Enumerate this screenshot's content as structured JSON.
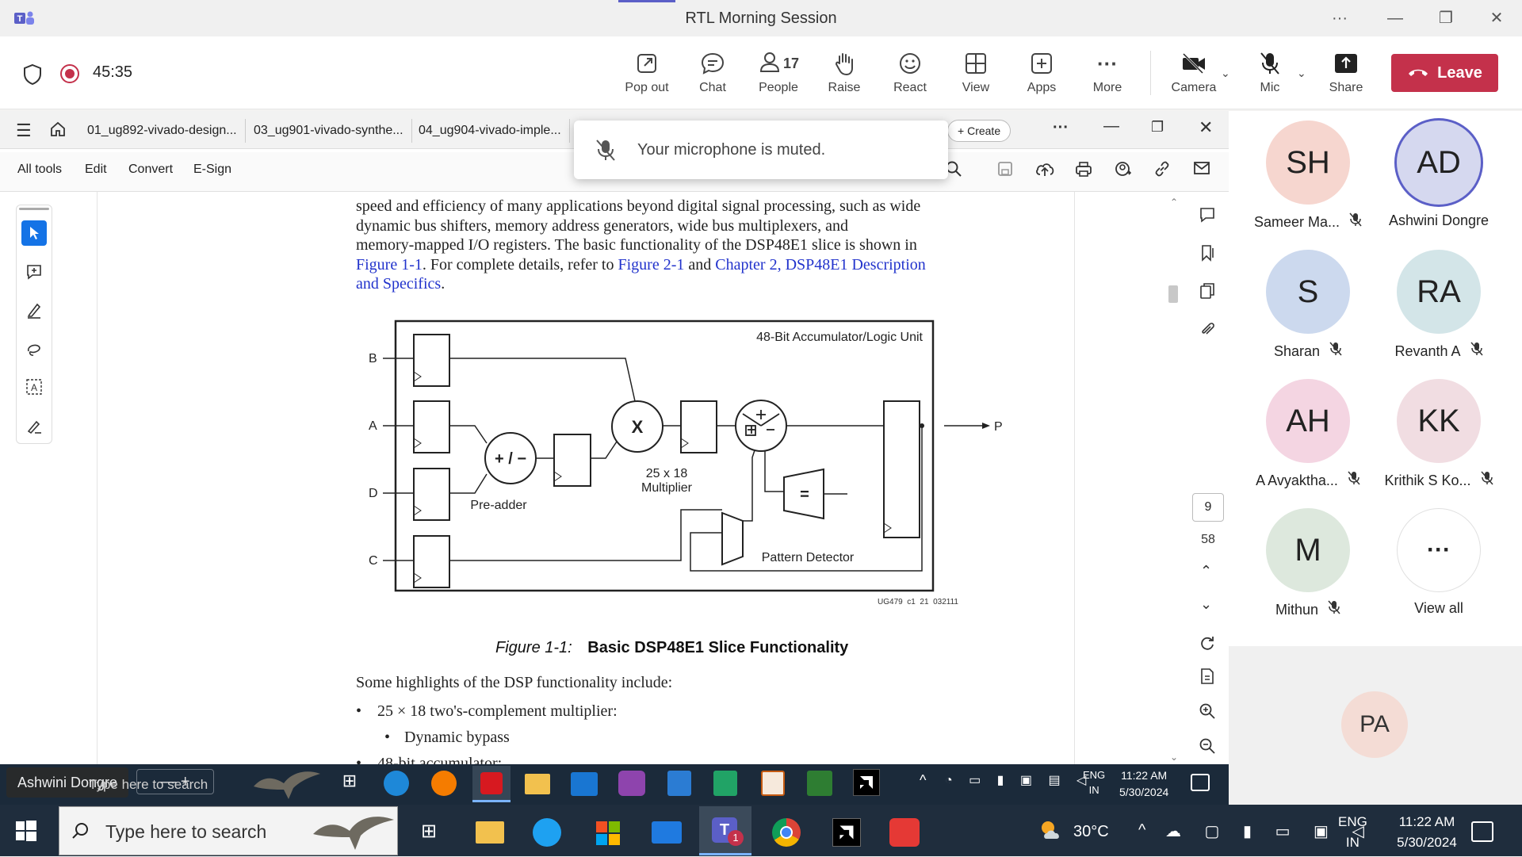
{
  "teams": {
    "window_title": "RTL Morning Session",
    "timer": "45:35",
    "toolbar": [
      {
        "label": "Pop out"
      },
      {
        "label": "Chat"
      },
      {
        "label": "People",
        "count": "17"
      },
      {
        "label": "Raise"
      },
      {
        "label": "React"
      },
      {
        "label": "View"
      },
      {
        "label": "Apps"
      },
      {
        "label": "More"
      },
      {
        "label": "Camera"
      },
      {
        "label": "Mic"
      },
      {
        "label": "Share"
      }
    ],
    "leave_label": "Leave",
    "mute_toast": "Your microphone is muted.",
    "colors": {
      "brand": "#5b5fc7",
      "leave": "#c4314b",
      "rec": "#c4314b"
    }
  },
  "acrobat": {
    "tabs": [
      "01_ug892-vivado-design...",
      "03_ug901-vivado-synthe...",
      "04_ug904-vivado-imple..."
    ],
    "create_label": "Create",
    "menus": [
      "All tools",
      "Edit",
      "Convert",
      "E-Sign"
    ],
    "page_current": "9",
    "page_total": "58"
  },
  "doc": {
    "para_lines": [
      "speed and efficiency of many applications beyond digital signal processing, such as wide",
      "dynamic bus shifters, memory address generators, wide bus multiplexers, and",
      "memory-mapped I/O registers. The basic functionality of the DSP48E1 slice is shown in"
    ],
    "link_line": {
      "l1": "Figure 1-1",
      "t1": ". For complete details, refer to ",
      "l2": "Figure 2-1",
      "t2": " and ",
      "l3": "Chapter 2, DSP48E1 Description"
    },
    "link_line2": "and Specifics",
    "link_line2_tail": ".",
    "figure": {
      "unit_label": "48-Bit Accumulator/Logic Unit",
      "inputs": [
        "B",
        "A",
        "D",
        "C"
      ],
      "output": "P",
      "multiplier_sym": "X",
      "multiplier_label1": "25 x 18",
      "multiplier_label2": "Multiplier",
      "preadder_sym": "+ / −",
      "preadder_label": "Pre-adder",
      "eq_sym": "=",
      "pattern_label": "Pattern Detector",
      "fig_code": "UG479_c1_21_032111",
      "caption_num": "Figure 1-1:",
      "caption_title": "Basic DSP48E1 Slice Functionality"
    },
    "highlights_intro": "Some highlights of the DSP functionality include:",
    "bullet1": "25 × 18 two's-complement multiplier:",
    "sub_bullet1": "Dynamic bypass",
    "bullet2": "48-bit accumulator:"
  },
  "participants": [
    {
      "initials": "SH",
      "name": "Sameer Ma...",
      "muted": true,
      "color": "#f6d6cf"
    },
    {
      "initials": "AD",
      "name": "Ashwini Dongre",
      "muted": false,
      "color": "#d5d8ef"
    },
    {
      "initials": "S",
      "name": "Sharan",
      "muted": true,
      "color": "#ccd9ee"
    },
    {
      "initials": "RA",
      "name": "Revanth A",
      "muted": true,
      "color": "#d3e5e8"
    },
    {
      "initials": "AH",
      "name": "A Avyaktha...",
      "muted": true,
      "color": "#f4d5e2"
    },
    {
      "initials": "KK",
      "name": "Krithik S Ko...",
      "muted": true,
      "color": "#f1dde2"
    },
    {
      "initials": "M",
      "name": "Mithun",
      "muted": true,
      "color": "#dde8dd"
    },
    {
      "initials": "···",
      "name": "View all",
      "muted": false,
      "color": "#ffffff"
    }
  ],
  "self_tile": {
    "initials": "PA"
  },
  "inner_taskbar": {
    "presenter": "Ashwini Dongre",
    "search": "Type here to search",
    "lang1": "ENG",
    "lang2": "IN",
    "time": "11:22 AM",
    "date": "5/30/2024"
  },
  "taskbar": {
    "search_placeholder": "Type here to search",
    "weather": "30°C",
    "lang1": "ENG",
    "lang2": "IN",
    "time": "11:22 AM",
    "date": "5/30/2024",
    "teams_badge": "1"
  }
}
